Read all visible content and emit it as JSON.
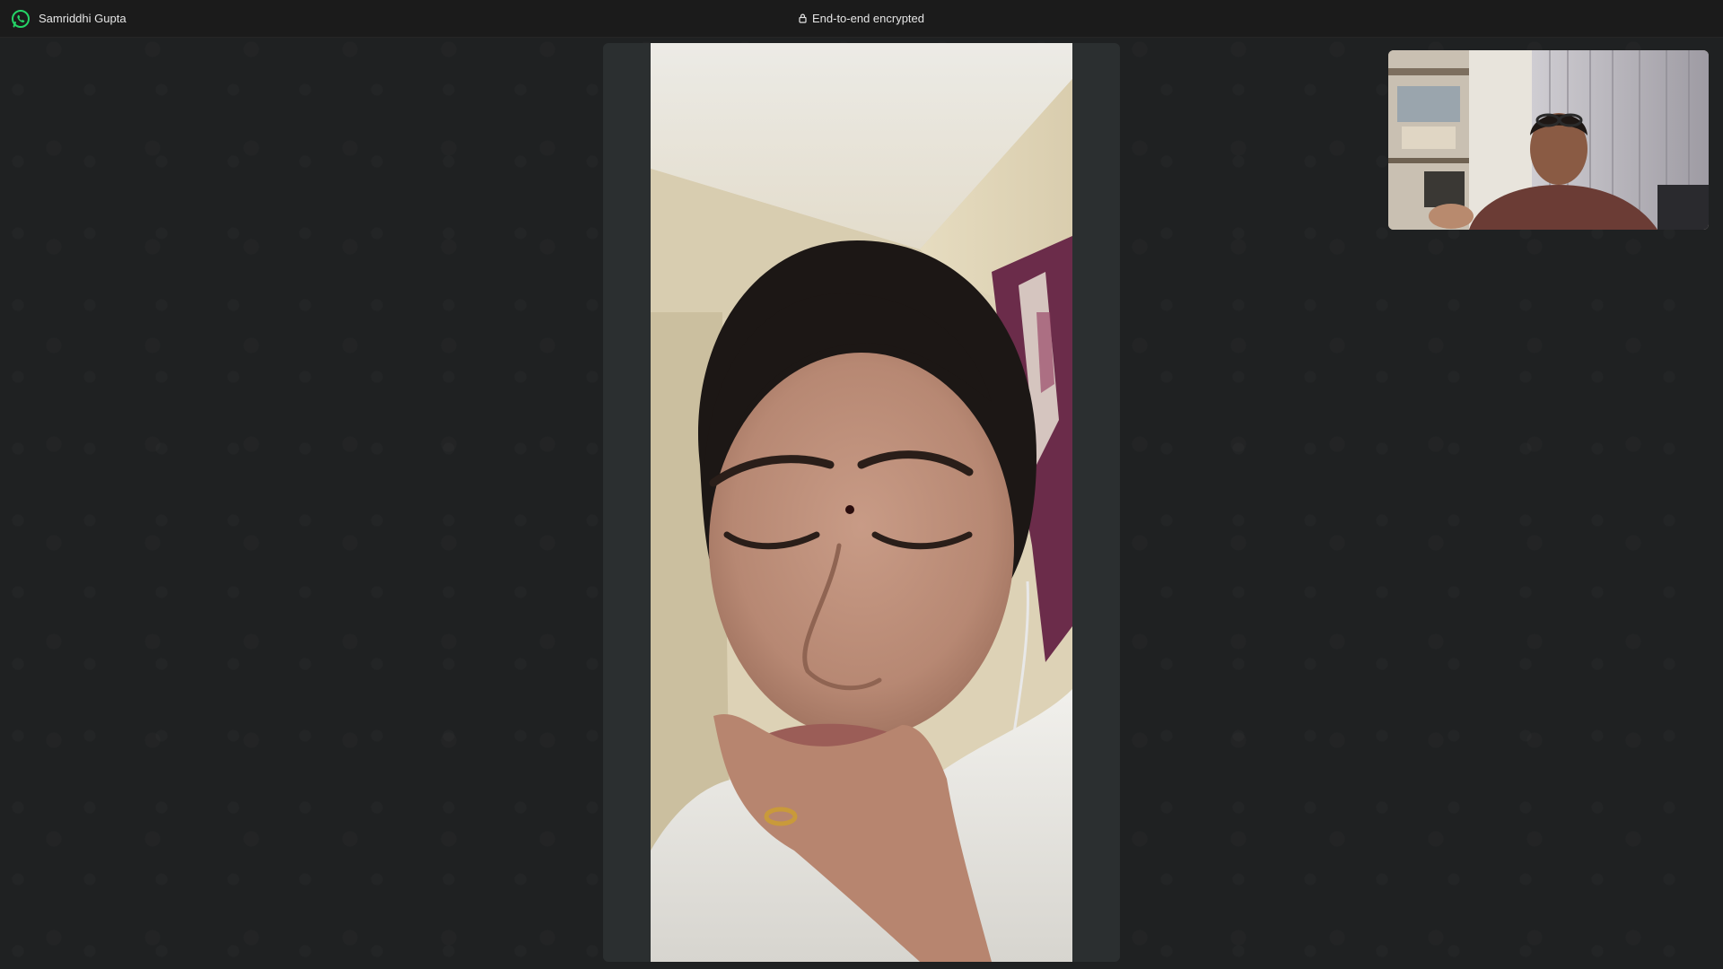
{
  "titlebar": {
    "app_icon": "whatsapp-icon",
    "caller_name": "Samriddhi Gupta",
    "encryption_icon": "lock-icon",
    "encryption_text": "End-to-end encrypted"
  },
  "call": {
    "remote_video": "remote-participant-video",
    "self_video": "self-preview-video"
  },
  "colors": {
    "background": "#1f2122",
    "titlebar": "#1b1b1b",
    "brand_green": "#25d366",
    "video_frame": "#2b2f30"
  }
}
